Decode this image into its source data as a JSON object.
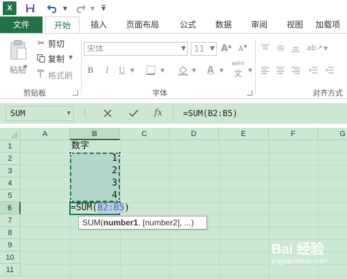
{
  "app": {
    "logo_text": "X",
    "accent": "#217346",
    "grid_bg": "#cde8d2"
  },
  "quick_access": {
    "icons": [
      "save-icon",
      "undo-icon",
      "redo-icon",
      "customize-icon"
    ]
  },
  "tabs": {
    "file": "文件",
    "home": "开始",
    "insert": "插入",
    "page_layout": "页面布局",
    "formulas": "公式",
    "data": "数据",
    "review": "审阅",
    "view": "视图",
    "addins": "加载项"
  },
  "ribbon": {
    "clipboard": {
      "paste": "粘贴",
      "cut": "剪切",
      "copy": "复制",
      "format_painter": "格式刷",
      "group_label": "剪贴板"
    },
    "font": {
      "font_name": "宋体",
      "font_size": "11",
      "bold": "B",
      "italic": "I",
      "underline": "U",
      "group_label": "字体",
      "phonetic": "wén"
    },
    "alignment": {
      "group_label": "对齐方式"
    }
  },
  "formula_bar": {
    "name_box": "SUM",
    "formula": "=SUM(B2:B5)",
    "fx": "fx"
  },
  "grid": {
    "columns": [
      "A",
      "B",
      "C",
      "D",
      "E",
      "F",
      "G"
    ],
    "rows": [
      "1",
      "2",
      "3",
      "4",
      "5",
      "6",
      "7",
      "8",
      "9",
      "10",
      "11"
    ],
    "active_column": "B",
    "active_row": "6",
    "cells": {
      "B1": "数字",
      "B2": "1",
      "B3": "2",
      "B4": "3",
      "B5": "4",
      "B6_prefix": "=SUM(",
      "B6_ref": "B2:B5",
      "B6_suffix": ")"
    },
    "tooltip": {
      "func": "SUM(",
      "arg1": "number1",
      "rest": ", [number2], ...)"
    }
  },
  "watermark": {
    "text": "Bai 经验",
    "sub": "jingyan.baidu.com"
  }
}
